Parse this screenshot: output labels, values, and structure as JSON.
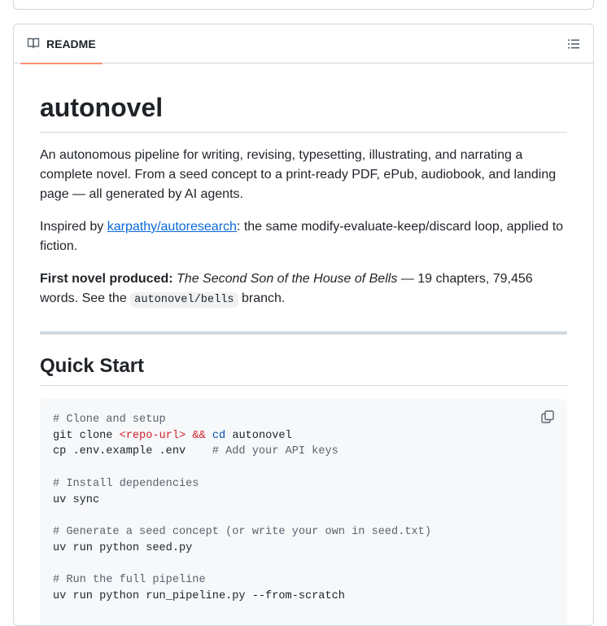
{
  "readme_tab": {
    "label": "README"
  },
  "title": "autonovel",
  "intro": "An autonomous pipeline for writing, revising, typesetting, illustrating, and narrating a complete novel. From a seed concept to a print-ready PDF, ePub, audiobook, and landing page — all generated by AI agents.",
  "inspired": {
    "prefix": "Inspired by ",
    "link_text": "karpathy/autoresearch",
    "suffix": ": the same modify-evaluate-keep/discard loop, applied to fiction."
  },
  "first_novel": {
    "label": "First novel produced:",
    "book_title": "The Second Son of the House of Bells",
    "details": " — 19 chapters, 79,456 words. See the ",
    "branch": "autonovel/bells",
    "suffix": " branch."
  },
  "quick_start": {
    "heading": "Quick Start",
    "lines": {
      "c1": "# Clone and setup",
      "l2a": "git clone ",
      "l2b": "<repo-url>",
      "l2c": " ",
      "l2d": "&&",
      "l2e": " ",
      "l2f": "cd",
      "l2g": " autonovel",
      "l3a": "cp .env.example .env    ",
      "l3b": "# Add your API keys",
      "c2": "# Install dependencies",
      "l5": "uv sync",
      "c3": "# Generate a seed concept (or write your own in seed.txt)",
      "l7": "uv run python seed.py",
      "c4": "# Run the full pipeline",
      "l9": "uv run python run_pipeline.py --from-scratch"
    }
  },
  "colors": {
    "tab_underline": "#fd8c73",
    "link": "#0969da",
    "border": "#d1d9e0"
  },
  "icons": {
    "readme": "book-icon",
    "toc": "list-unordered-icon",
    "copy": "copy-icon"
  }
}
